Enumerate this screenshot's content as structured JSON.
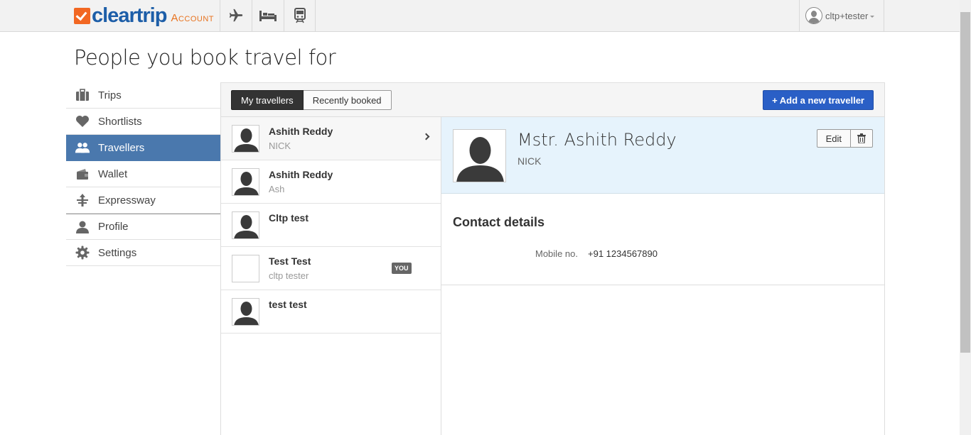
{
  "header": {
    "logo_text": "cleartrip",
    "logo_suffix": "Account",
    "nav_icons": [
      "airplane-icon",
      "bed-icon",
      "train-icon"
    ],
    "user_name": "cltp+tester"
  },
  "page_title": "People you book travel for",
  "sidebar": {
    "items": [
      {
        "label": "Trips",
        "icon": "suitcase-icon"
      },
      {
        "label": "Shortlists",
        "icon": "heart-icon"
      },
      {
        "label": "Travellers",
        "icon": "people-icon",
        "active": true
      },
      {
        "label": "Wallet",
        "icon": "wallet-icon"
      },
      {
        "label": "Expressway",
        "icon": "expressway-icon"
      },
      {
        "label": "Profile",
        "icon": "person-icon"
      },
      {
        "label": "Settings",
        "icon": "gear-icon"
      }
    ]
  },
  "tabs": {
    "my_travellers": "My travellers",
    "recently_booked": "Recently booked"
  },
  "add_button": "+ Add a new traveller",
  "travellers": [
    {
      "name": "Ashith Reddy",
      "sub": "NICK",
      "selected": true
    },
    {
      "name": "Ashith Reddy",
      "sub": "Ash"
    },
    {
      "name": "Cltp test",
      "sub": ""
    },
    {
      "name": "Test Test",
      "sub": "cltp tester",
      "badge": "YOU"
    },
    {
      "name": "test test",
      "sub": ""
    }
  ],
  "detail": {
    "name": "Mstr. Ashith Reddy",
    "nick": "NICK",
    "edit_label": "Edit",
    "contact_title": "Contact details",
    "mobile_label": "Mobile no.",
    "mobile_value": "+91 1234567890"
  },
  "colors": {
    "brand_orange": "#f26722",
    "brand_blue": "#1d5ea8",
    "active_sidebar": "#4a78ad",
    "add_button": "#2a5fc6",
    "detail_bg": "#e6f3fc"
  }
}
